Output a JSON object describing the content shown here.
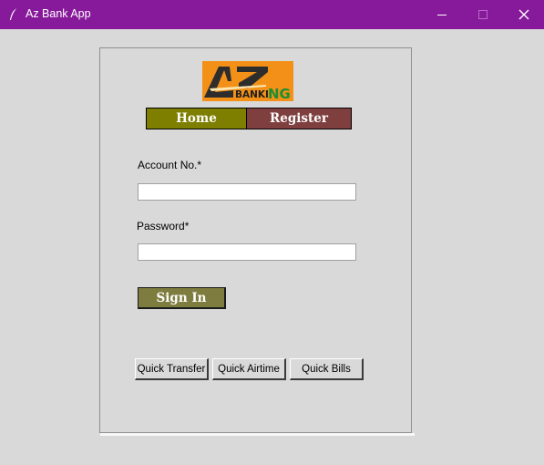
{
  "window": {
    "title": "Az Bank App",
    "titlebar_color": "#871a9a",
    "icons": {
      "app": "feather-icon",
      "minimize": "minimize-icon",
      "maximize": "maximize-icon",
      "close": "close-icon"
    }
  },
  "logo": {
    "brand_main": "AZ",
    "brand_prefix": "BANKI",
    "brand_suffix": "NG",
    "background": "#f39018"
  },
  "nav": {
    "home_label": "Home",
    "register_label": "Register",
    "home_color": "#7e7e00",
    "register_color": "#7f3f3f"
  },
  "form": {
    "account_label": "Account No.*",
    "account_value": "",
    "password_label": "Password*",
    "password_value": "",
    "signin_label": "Sign In",
    "signin_color": "#7e7d3f"
  },
  "quick": {
    "transfer_label": "Quick Transfer",
    "airtime_label": "Quick Airtime",
    "bills_label": "Quick Bills"
  }
}
